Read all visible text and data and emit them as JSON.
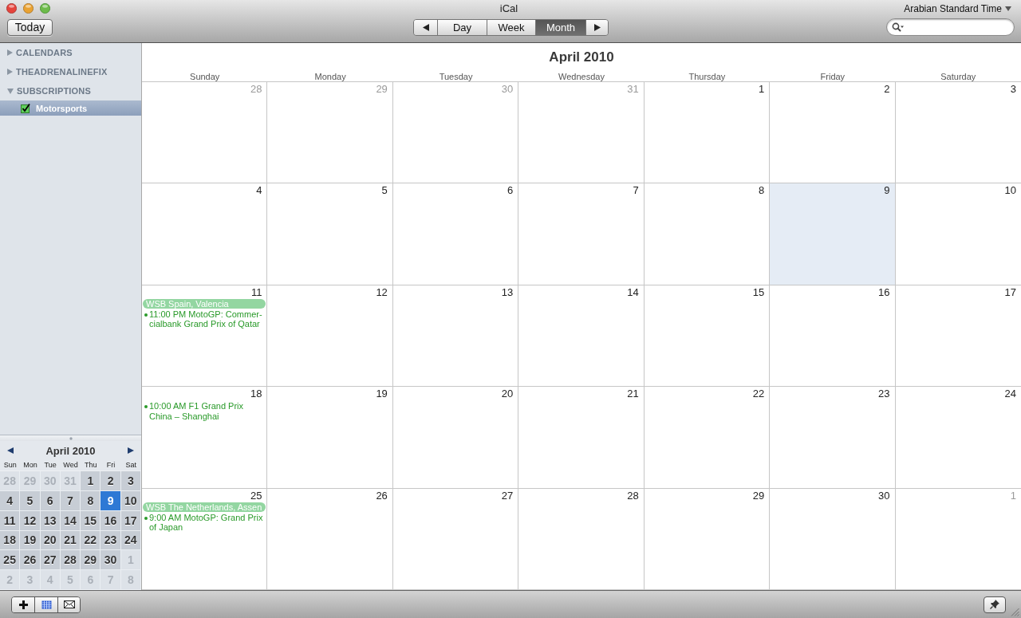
{
  "window": {
    "title": "iCal"
  },
  "toolbar": {
    "today_button": "Today",
    "views": [
      {
        "label": "Day",
        "selected": false
      },
      {
        "label": "Week",
        "selected": false
      },
      {
        "label": "Month",
        "selected": true
      }
    ],
    "time_zone": "Arabian Standard Time"
  },
  "sidebar": {
    "groups": [
      {
        "label": "CALENDARS",
        "expanded": false
      },
      {
        "label": "THEADRENALINEFIX",
        "expanded": false
      },
      {
        "label": "SUBSCRIPTIONS",
        "expanded": true,
        "children": [
          {
            "label": "Motorsports",
            "checked": true,
            "selected": true
          }
        ]
      }
    ]
  },
  "mini_calendar": {
    "title": "April 2010",
    "weekdays": [
      "Sun",
      "Mon",
      "Tue",
      "Wed",
      "Thu",
      "Fri",
      "Sat"
    ],
    "days": [
      {
        "label": "28",
        "in_month": false,
        "selected": false
      },
      {
        "label": "29",
        "in_month": false,
        "selected": false
      },
      {
        "label": "30",
        "in_month": false,
        "selected": false
      },
      {
        "label": "31",
        "in_month": false,
        "selected": false
      },
      {
        "label": "1",
        "in_month": true,
        "selected": false
      },
      {
        "label": "2",
        "in_month": true,
        "selected": false
      },
      {
        "label": "3",
        "in_month": true,
        "selected": false
      },
      {
        "label": "4",
        "in_month": true,
        "selected": false
      },
      {
        "label": "5",
        "in_month": true,
        "selected": false
      },
      {
        "label": "6",
        "in_month": true,
        "selected": false
      },
      {
        "label": "7",
        "in_month": true,
        "selected": false
      },
      {
        "label": "8",
        "in_month": true,
        "selected": false
      },
      {
        "label": "9",
        "in_month": true,
        "selected": true
      },
      {
        "label": "10",
        "in_month": true,
        "selected": false
      },
      {
        "label": "11",
        "in_month": true,
        "selected": false
      },
      {
        "label": "12",
        "in_month": true,
        "selected": false
      },
      {
        "label": "13",
        "in_month": true,
        "selected": false
      },
      {
        "label": "14",
        "in_month": true,
        "selected": false
      },
      {
        "label": "15",
        "in_month": true,
        "selected": false
      },
      {
        "label": "16",
        "in_month": true,
        "selected": false
      },
      {
        "label": "17",
        "in_month": true,
        "selected": false
      },
      {
        "label": "18",
        "in_month": true,
        "selected": false
      },
      {
        "label": "19",
        "in_month": true,
        "selected": false
      },
      {
        "label": "20",
        "in_month": true,
        "selected": false
      },
      {
        "label": "21",
        "in_month": true,
        "selected": false
      },
      {
        "label": "22",
        "in_month": true,
        "selected": false
      },
      {
        "label": "23",
        "in_month": true,
        "selected": false
      },
      {
        "label": "24",
        "in_month": true,
        "selected": false
      },
      {
        "label": "25",
        "in_month": true,
        "selected": false
      },
      {
        "label": "26",
        "in_month": true,
        "selected": false
      },
      {
        "label": "27",
        "in_month": true,
        "selected": false
      },
      {
        "label": "28",
        "in_month": true,
        "selected": false
      },
      {
        "label": "29",
        "in_month": true,
        "selected": false
      },
      {
        "label": "30",
        "in_month": true,
        "selected": false
      },
      {
        "label": "1",
        "in_month": false,
        "selected": false
      },
      {
        "label": "2",
        "in_month": false,
        "selected": false
      },
      {
        "label": "3",
        "in_month": false,
        "selected": false
      },
      {
        "label": "4",
        "in_month": false,
        "selected": false
      },
      {
        "label": "5",
        "in_month": false,
        "selected": false
      },
      {
        "label": "6",
        "in_month": false,
        "selected": false
      },
      {
        "label": "7",
        "in_month": false,
        "selected": false
      },
      {
        "label": "8",
        "in_month": false,
        "selected": false
      }
    ]
  },
  "calendar": {
    "title": "April 2010",
    "weekdays": [
      "Sunday",
      "Monday",
      "Tuesday",
      "Wednesday",
      "Thursday",
      "Friday",
      "Saturday"
    ],
    "days": [
      {
        "day": "28",
        "in_month": false,
        "today": false
      },
      {
        "day": "29",
        "in_month": false,
        "today": false
      },
      {
        "day": "30",
        "in_month": false,
        "today": false
      },
      {
        "day": "31",
        "in_month": false,
        "today": false
      },
      {
        "day": "1",
        "in_month": true,
        "today": false
      },
      {
        "day": "2",
        "in_month": true,
        "today": false
      },
      {
        "day": "3",
        "in_month": true,
        "today": false
      },
      {
        "day": "4",
        "in_month": true,
        "today": false
      },
      {
        "day": "5",
        "in_month": true,
        "today": false
      },
      {
        "day": "6",
        "in_month": true,
        "today": false
      },
      {
        "day": "7",
        "in_month": true,
        "today": false
      },
      {
        "day": "8",
        "in_month": true,
        "today": false
      },
      {
        "day": "9",
        "in_month": true,
        "today": true
      },
      {
        "day": "10",
        "in_month": true,
        "today": false
      },
      {
        "day": "11",
        "in_month": true,
        "today": false,
        "events": [
          {
            "kind": "all_day",
            "title": "WSB Spain, Valencia"
          },
          {
            "kind": "timed",
            "time": "11:00 PM",
            "title": "MotoGP: Commer-cialbank Grand Prix of Qatar"
          }
        ]
      },
      {
        "day": "12",
        "in_month": true,
        "today": false
      },
      {
        "day": "13",
        "in_month": true,
        "today": false
      },
      {
        "day": "14",
        "in_month": true,
        "today": false
      },
      {
        "day": "15",
        "in_month": true,
        "today": false
      },
      {
        "day": "16",
        "in_month": true,
        "today": false
      },
      {
        "day": "17",
        "in_month": true,
        "today": false
      },
      {
        "day": "18",
        "in_month": true,
        "today": false,
        "events": [
          {
            "kind": "timed",
            "time": "10:00 AM",
            "title": "F1 Grand Prix China – Shanghai"
          }
        ]
      },
      {
        "day": "19",
        "in_month": true,
        "today": false
      },
      {
        "day": "20",
        "in_month": true,
        "today": false
      },
      {
        "day": "21",
        "in_month": true,
        "today": false
      },
      {
        "day": "22",
        "in_month": true,
        "today": false
      },
      {
        "day": "23",
        "in_month": true,
        "today": false
      },
      {
        "day": "24",
        "in_month": true,
        "today": false
      },
      {
        "day": "25",
        "in_month": true,
        "today": false,
        "events": [
          {
            "kind": "all_day",
            "title": "WSB The Netherlands, Assen"
          },
          {
            "kind": "timed",
            "time": "9:00 AM",
            "title": "MotoGP: Grand Prix of Japan"
          }
        ]
      },
      {
        "day": "26",
        "in_month": true,
        "today": false
      },
      {
        "day": "27",
        "in_month": true,
        "today": false
      },
      {
        "day": "28",
        "in_month": true,
        "today": false
      },
      {
        "day": "29",
        "in_month": true,
        "today": false
      },
      {
        "day": "30",
        "in_month": true,
        "today": false
      },
      {
        "day": "1",
        "in_month": false,
        "today": false
      }
    ]
  }
}
